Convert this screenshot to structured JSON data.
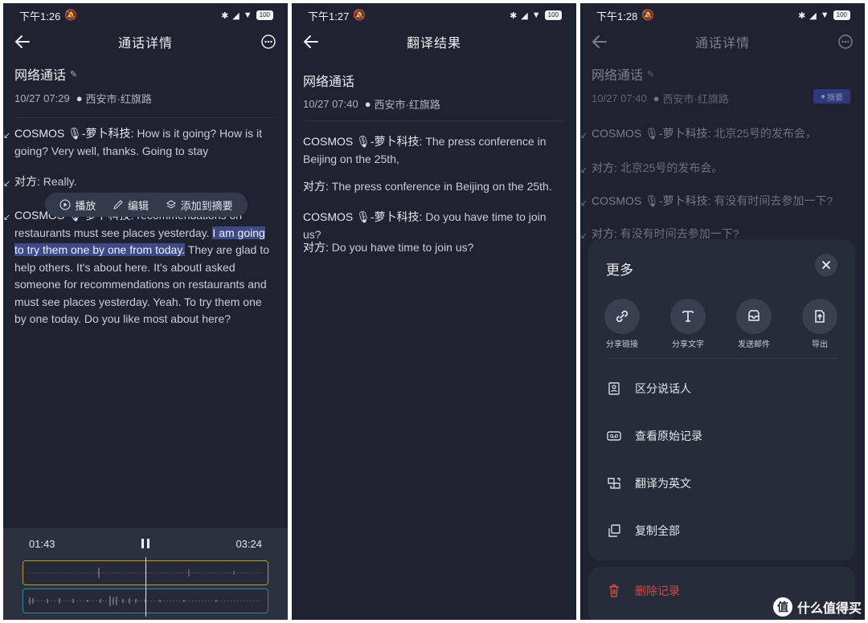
{
  "panel1": {
    "status": {
      "time": "下午1:26",
      "battery": "100"
    },
    "title": "通话详情",
    "call_title": "网络通话",
    "date": "10/27 07:29",
    "location": "西安市·红旗路",
    "lines": [
      {
        "speaker": "COSMOS 🎙-萝卜科技:",
        "text": " How is it going? How is it going? Very well, thanks. Going to stay"
      },
      {
        "speaker": "对方:",
        "text": " Really."
      }
    ],
    "para3": {
      "speaker": "COSMOS 🎙-萝卜科技:",
      "pre": " recommendations on restaurants must see places yesterday. ",
      "selected": "I am going to try them one by one from today.",
      "post": " They are glad to help others. It's about here. It's aboutI asked someone for recommendations on restaurants and must see places yesterday. Yeah. To try them one by one today. Do you like most about here?"
    },
    "popup": {
      "play": "播放",
      "edit": "编辑",
      "add_summary": "添加到摘要"
    },
    "player": {
      "current": "01:43",
      "total": "03:24"
    }
  },
  "panel2": {
    "status": {
      "time": "下午1:27",
      "battery": "100"
    },
    "title": "翻译结果",
    "call_title": "网络通话",
    "date": "10/27 07:40",
    "location": "西安市·红旗路",
    "lines": [
      {
        "speaker": "COSMOS 🎙-萝卜科技:",
        "text": " The press conference in Beijing on the 25th,"
      },
      {
        "speaker": "对方:",
        "text": " The press conference in Beijing on the 25th."
      },
      {
        "speaker": "COSMOS 🎙-萝卜科技:",
        "text": " Do you have time to join us?"
      },
      {
        "speaker": "对方:",
        "text": " Do you have time to join us?"
      }
    ]
  },
  "panel3": {
    "status": {
      "time": "下午1:28",
      "battery": "100"
    },
    "title": "通话详情",
    "call_title": "网络通话",
    "date": "10/27 07:40",
    "location": "西安市·红旗路",
    "summary_chip": "摘要",
    "lines": [
      {
        "speaker": "COSMOS 🎙-萝卜科技:",
        "text": " 北京25号的发布会，"
      },
      {
        "speaker": "对方:",
        "text": " 北京25号的发布会。"
      },
      {
        "speaker": "COSMOS 🎙-萝卜科技:",
        "text": " 有没有时间去参加一下?"
      },
      {
        "speaker": "对方:",
        "text": " 有没有时间去参加一下?"
      }
    ],
    "sheet": {
      "title": "更多",
      "share": [
        {
          "label": "分享链接",
          "icon": "link-icon"
        },
        {
          "label": "分享文字",
          "icon": "text-icon"
        },
        {
          "label": "发送邮件",
          "icon": "mail-icon"
        },
        {
          "label": "导出",
          "icon": "export-icon"
        }
      ],
      "menu": [
        {
          "label": "区分说话人",
          "icon": "speaker-icon"
        },
        {
          "label": "查看原始记录",
          "icon": "tape-icon"
        },
        {
          "label": "翻译为英文",
          "icon": "translate-icon"
        },
        {
          "label": "复制全部",
          "icon": "copy-icon"
        }
      ],
      "delete": "删除记录"
    }
  },
  "watermark": {
    "glyph": "值",
    "text": "什么值得买"
  }
}
